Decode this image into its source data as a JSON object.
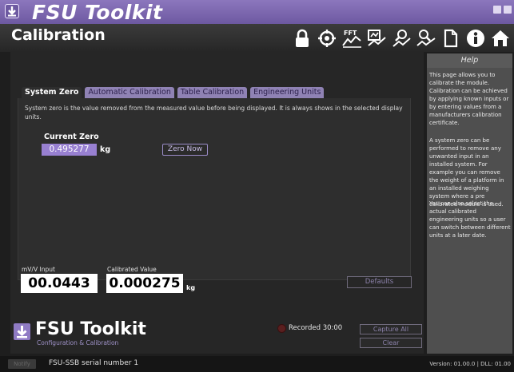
{
  "titlebar": {
    "title": "FSU Toolkit"
  },
  "header": {
    "page_title": "Calibration",
    "toolbar_icons": [
      "lock-icon",
      "target-icon",
      "fft-chart-icon",
      "chart-icon",
      "search-chart-icon",
      "chart-search-alt-icon",
      "document-icon",
      "info-icon",
      "home-icon"
    ],
    "fft_label": "FFT"
  },
  "tabs": [
    {
      "label": "System Zero",
      "active": true
    },
    {
      "label": "Automatic Calibration",
      "active": false
    },
    {
      "label": "Table Calibration",
      "active": false
    },
    {
      "label": "Engineering Units",
      "active": false
    }
  ],
  "system_zero": {
    "description": "System zero is the value removed from the measured value before being displayed. It is always shows in the selected display units.",
    "current_zero_label": "Current Zero",
    "current_zero_value": "0.495277",
    "unit": "kg",
    "zero_now_label": "Zero Now"
  },
  "readings": {
    "mv_label": "mV/V Input",
    "mv_value": "00.0443",
    "cal_label": "Calibrated Value",
    "cal_value": "0.000275",
    "cal_unit": "kg",
    "defaults_label": "Defaults"
  },
  "branding": {
    "name": "FSU Toolkit",
    "subtitle": "Configuration & Calibration"
  },
  "recording": {
    "text": "Recorded 30:00",
    "capture_all_label": "Capture All",
    "clear_label": "Clear"
  },
  "help": {
    "title": "Help",
    "paragraphs": [
      "This page allows you to calibrate the module. Calibration can be achieved by applying known inputs or by entering values from a manufacturers calibration certificate.",
      "A system zero can be performed to remove any unwanted input in an installed system. For example you can remove the weight of a platform in an installed weighing system where a pre calibrated module is used.",
      "You can also select the actual calibrated engineering units so a user can switch between different units at a later date."
    ]
  },
  "statusbar": {
    "chip": "Notify",
    "device": "FSU-SSB serial number 1",
    "version": "Version: 01.00.0 | DLL: 01.00"
  },
  "colors": {
    "accent": "#8c77bd",
    "value_box": "#9880d1",
    "help_bg": "#4f4f4f"
  }
}
